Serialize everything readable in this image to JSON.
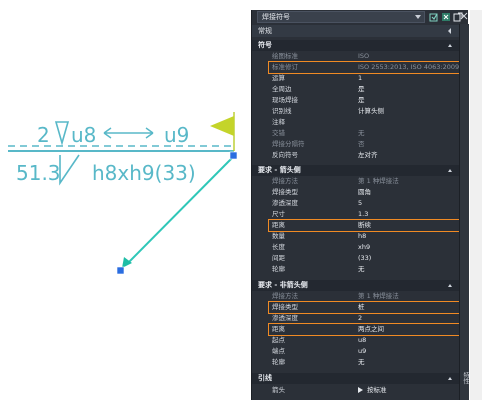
{
  "canvas": {
    "line1": "2",
    "u8_top": "u8",
    "u9_top": "u9",
    "line2_left": "51.3",
    "line2_right": "h8xh9(33)"
  },
  "palette": {
    "selector": "焊接符号",
    "general_tab": "常规",
    "side_tab": "特性",
    "sections": {
      "symbol": "符号",
      "arrow": "要求 - 箭头侧",
      "other": "要求 - 非箭头侧",
      "leader": "引线"
    },
    "symbol_rows": [
      {
        "k": "绘图标准",
        "v": "ISO"
      },
      {
        "k": "标准修订",
        "v": "ISO 2553:2013, ISO 4063:2009"
      },
      {
        "k": "运算",
        "v": "1"
      },
      {
        "k": "全周边",
        "v": "是"
      },
      {
        "k": "现场焊接",
        "v": "是"
      },
      {
        "k": "识别线",
        "v": "计算头侧"
      },
      {
        "k": "注释",
        "v": ""
      },
      {
        "k": "交错",
        "v": "无"
      },
      {
        "k": "焊接分隔符",
        "v": "否"
      },
      {
        "k": "反向符号",
        "v": "左对齐"
      }
    ],
    "arrow_rows": [
      {
        "k": "焊接方法",
        "v": "第 1 种焊接法"
      },
      {
        "k": "焊接类型",
        "v": "圆角"
      },
      {
        "k": "渗透深度",
        "v": "5"
      },
      {
        "k": "尺寸",
        "v": "1.3"
      },
      {
        "k": "距离",
        "v": "断续"
      },
      {
        "k": "数量",
        "v": "h8"
      },
      {
        "k": "长度",
        "v": "xh9"
      },
      {
        "k": "间距",
        "v": "(33)"
      },
      {
        "k": "轮廓",
        "v": "无"
      }
    ],
    "other_rows": [
      {
        "k": "焊接方法",
        "v": "第 1 种焊接法"
      },
      {
        "k": "焊接类型",
        "v": "桩"
      },
      {
        "k": "渗透深度",
        "v": "2"
      },
      {
        "k": "距离",
        "v": "两点之间"
      },
      {
        "k": "起点",
        "v": "u8"
      },
      {
        "k": "端点",
        "v": "u9"
      },
      {
        "k": "轮廓",
        "v": "无"
      }
    ],
    "leader_rows": [
      {
        "k": "箭头",
        "v": "按标准"
      }
    ]
  }
}
